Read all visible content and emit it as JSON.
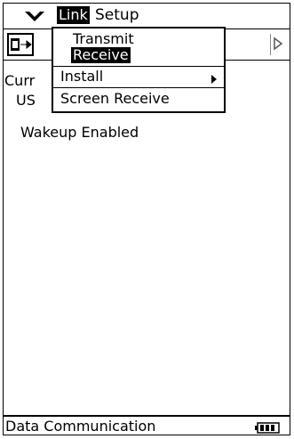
{
  "menubar": {
    "menu_icon": "chevron-down-icon",
    "link_label": "Link",
    "setup_label": "Setup"
  },
  "toolbar": {
    "left_button_icon": "transfer-icon",
    "right_button_icon": "scroll-right-icon"
  },
  "content": {
    "current_label": "Curr",
    "usb_label": "US",
    "wakeup_label": "Wakeup Enabled"
  },
  "dropdown": {
    "transmit_label": "Transmit",
    "receive_label": "Receive",
    "install_label": "Install",
    "screen_receive_label": "Screen Receive",
    "submenu_arrow_icon": "caret-right-icon"
  },
  "status": {
    "text": "Data Communication",
    "battery_icon": "battery-icon"
  },
  "colors": {
    "background": "#ffffff",
    "foreground": "#000000",
    "highlight": "#000000",
    "highlight_text": "#ffffff"
  }
}
